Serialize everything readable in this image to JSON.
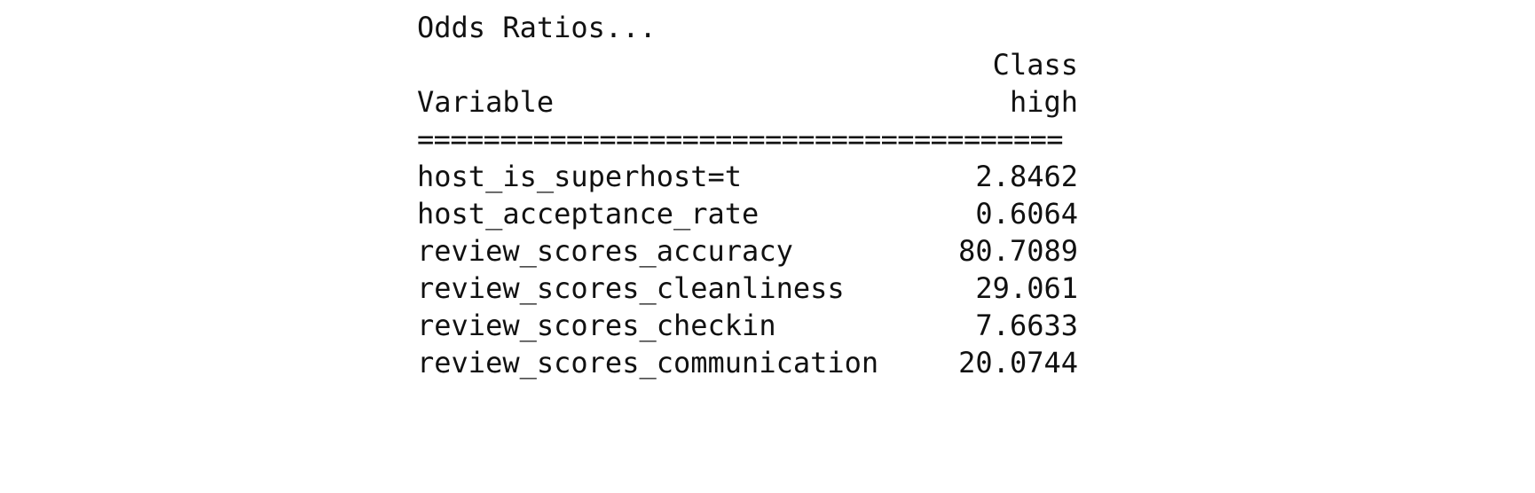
{
  "output": {
    "title": "Odds Ratios...",
    "header": {
      "class_label": "Class",
      "variable_label": "Variable",
      "class_value": "high"
    },
    "separator": "=======================================",
    "rows": [
      {
        "variable": "host_is_superhost=t",
        "value": "2.8462"
      },
      {
        "variable": "host_acceptance_rate",
        "value": "0.6064"
      },
      {
        "variable": "review_scores_accuracy",
        "value": "80.7089"
      },
      {
        "variable": "review_scores_cleanliness",
        "value": "29.061"
      },
      {
        "variable": "review_scores_checkin",
        "value": "7.6633"
      },
      {
        "variable": "review_scores_communication",
        "value": "20.0744"
      }
    ]
  }
}
